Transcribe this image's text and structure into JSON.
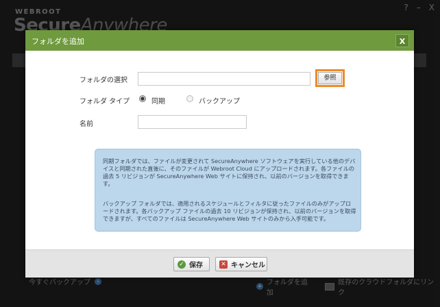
{
  "background": {
    "brand_small": "WEBROOT",
    "brand_main_a": "Secure",
    "brand_main_b": "Anywhere",
    "win_help": "?",
    "win_minimize": "–",
    "win_close": "X",
    "bottom_left_text": "今すぐバックアップ",
    "bottom_add_folder": "フォルダを追加",
    "bottom_link_text": "既存のクラウドフォルダにリンク"
  },
  "dialog": {
    "title": "フォルダを追加",
    "close_label": "X",
    "folder_select_label": "フォルダの選択",
    "folder_path_value": "",
    "browse_label": "参照",
    "folder_type_label": "フォルダ タイプ",
    "sync_label": "同期",
    "backup_label": "バックアップ",
    "name_label": "名前",
    "name_value": "",
    "info_sync": "同期フォルダでは、ファイルが変更されて SecureAnywhere ソフトウェアを実行している他のデバイスと同期された直後に、そのファイルが Webroot Cloud にアップロードされます。各ファイルの過去 5 リビジョンが SecureAnywhere Web サイトに保持され、以前のバージョンを取得できます。",
    "info_backup": "バックアップ フォルダでは、適用されるスケジュールとフィルタに従ったファイルのみがアップロードされます。各バックアップ ファイルの過去 10 リビジョンが保持され、以前のバージョンを取得できますが、すべてのファイルは SecureAnywhere Web サイトのみから入手可能です。",
    "save_label": "保存",
    "cancel_label": "キャンセル"
  },
  "colors": {
    "titlebar": "#6f9a3d",
    "highlight": "#ef8a26",
    "info_bg": "#bcd6ec"
  }
}
